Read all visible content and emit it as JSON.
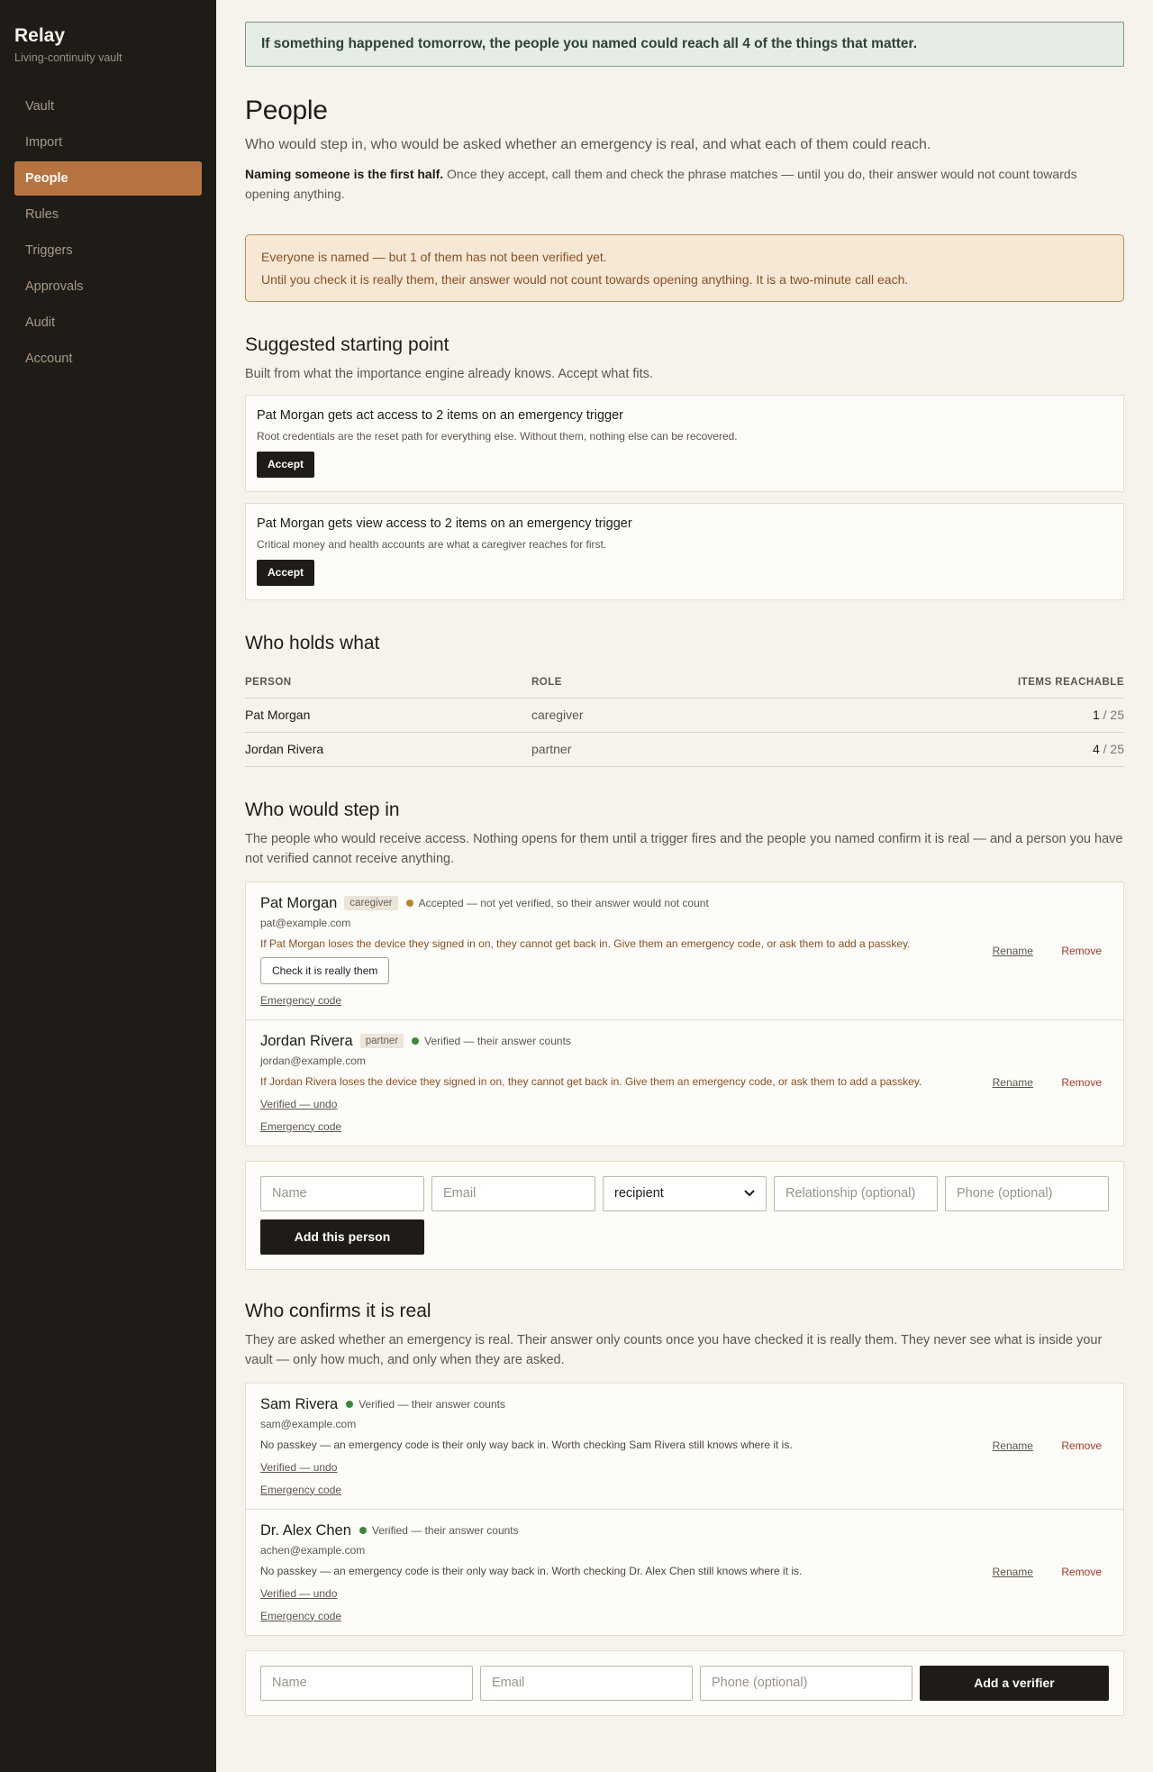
{
  "app": {
    "name": "Relay",
    "tagline": "Living-continuity vault"
  },
  "nav": [
    {
      "label": "Vault",
      "active": false
    },
    {
      "label": "Import",
      "active": false
    },
    {
      "label": "People",
      "active": true
    },
    {
      "label": "Rules",
      "active": false
    },
    {
      "label": "Triggers",
      "active": false
    },
    {
      "label": "Approvals",
      "active": false
    },
    {
      "label": "Audit",
      "active": false
    },
    {
      "label": "Account",
      "active": false
    }
  ],
  "banner": "If something happened tomorrow, the people you named could reach all 4 of the things that matter.",
  "page": {
    "title": "People",
    "lead": "Who would step in, who would be asked whether an emergency is real, and what each of them could reach.",
    "note_bold": "Naming someone is the first half.",
    "note_rest": " Once they accept, call them and check the phrase matches — until you do, their answer would not count towards opening anything."
  },
  "warning": {
    "line1": "Everyone is named — but 1 of them has not been verified yet.",
    "line2": "Until you check it is really them, their answer would not count towards opening anything. It is a two-minute call each."
  },
  "suggested": {
    "title": "Suggested starting point",
    "sub": "Built from what the importance engine already knows. Accept what fits.",
    "cards": [
      {
        "title": "Pat Morgan gets act access to 2 items on an emergency trigger",
        "desc": "Root credentials are the reset path for everything else. Without them, nothing else can be recovered.",
        "button": "Accept"
      },
      {
        "title": "Pat Morgan gets view access to 2 items on an emergency trigger",
        "desc": "Critical money and health accounts are what a caregiver reaches for first.",
        "button": "Accept"
      }
    ]
  },
  "holds": {
    "title": "Who holds what",
    "headers": {
      "person": "PERSON",
      "role": "ROLE",
      "items": "ITEMS REACHABLE"
    },
    "rows": [
      {
        "person": "Pat Morgan",
        "role": "caregiver",
        "count": "1",
        "total": " / 25"
      },
      {
        "person": "Jordan Rivera",
        "role": "partner",
        "count": "4",
        "total": " / 25"
      }
    ]
  },
  "stepin": {
    "title": "Who would step in",
    "sub": "The people who would receive access. Nothing opens for them until a trigger fires and the people you named confirm it is real — and a person you have not verified cannot receive anything.",
    "people": [
      {
        "name": "Pat Morgan",
        "role": "caregiver",
        "status": "Accepted — not yet verified, so their answer would not count",
        "email": "pat@example.com",
        "warn": "If Pat Morgan loses the device they signed in on, they cannot get back in. Give them an emergency code, or ask them to add a passkey.",
        "check": "Check it is really them",
        "code": "Emergency code",
        "rename": "Rename",
        "remove": "Remove"
      },
      {
        "name": "Jordan Rivera",
        "role": "partner",
        "status": "Verified — their answer counts",
        "email": "jordan@example.com",
        "warn": "If Jordan Rivera loses the device they signed in on, they cannot get back in. Give them an emergency code, or ask them to add a passkey.",
        "undo": "Verified — undo",
        "code": "Emergency code",
        "rename": "Rename",
        "remove": "Remove"
      }
    ],
    "form": {
      "name": "Name",
      "email": "Email",
      "role": "recipient",
      "relationship": "Relationship (optional)",
      "phone": "Phone (optional)",
      "button": "Add this person"
    }
  },
  "confirm": {
    "title": "Who confirms it is real",
    "sub": "They are asked whether an emergency is real. Their answer only counts once you have checked it is really them. They never see what is inside your vault — only how much, and only when they are asked.",
    "people": [
      {
        "name": "Sam Rivera",
        "status": "Verified — their answer counts",
        "email": "sam@example.com",
        "info": "No passkey — an emergency code is their only way back in. Worth checking Sam Rivera still knows where it is.",
        "undo": "Verified — undo",
        "code": "Emergency code",
        "rename": "Rename",
        "remove": "Remove"
      },
      {
        "name": "Dr. Alex Chen",
        "status": "Verified — their answer counts",
        "email": "achen@example.com",
        "info": "No passkey — an emergency code is their only way back in. Worth checking Dr. Alex Chen still knows where it is.",
        "undo": "Verified — undo",
        "code": "Emergency code",
        "rename": "Rename",
        "remove": "Remove"
      }
    ],
    "form": {
      "name": "Name",
      "email": "Email",
      "phone": "Phone (optional)",
      "button": "Add a verifier"
    }
  }
}
